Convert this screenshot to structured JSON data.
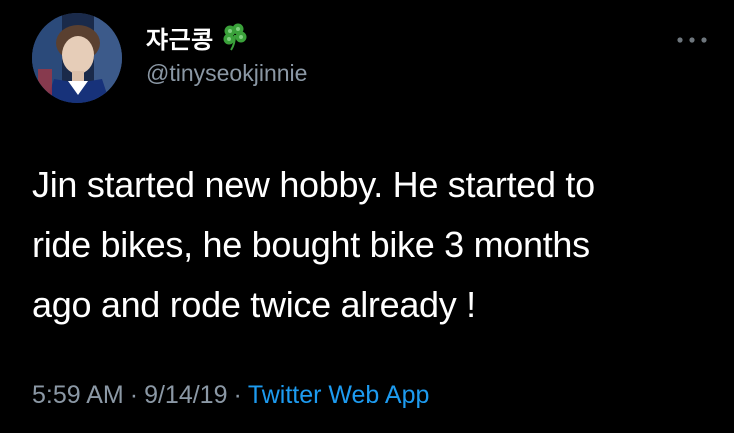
{
  "author": {
    "display_name": "쟈근콩",
    "username": "@tinyseokjinnie",
    "badge_icon": "four-leaf-clover-icon"
  },
  "tweet": {
    "lines": [
      "Jin started new hobby. He started to",
      "ride bikes, he bought bike 3 months",
      "ago and rode twice already !"
    ]
  },
  "meta": {
    "time": "5:59 AM",
    "separator": "·",
    "date": "9/14/19",
    "source": "Twitter Web App"
  },
  "colors": {
    "background": "#000000",
    "text": "#ffffff",
    "secondary": "#8b98a5",
    "link": "#1d9bf0",
    "clover": "#3aa13a"
  }
}
